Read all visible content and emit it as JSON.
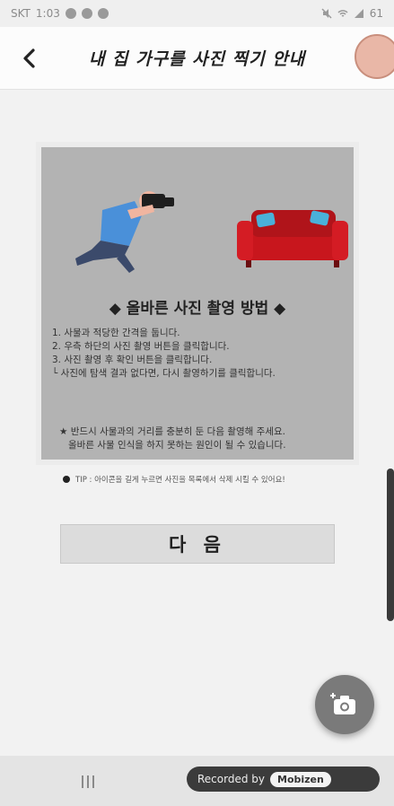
{
  "status_bar": {
    "carrier": "SKT",
    "time": "1:03",
    "battery": "61"
  },
  "header": {
    "title": "내 집 가구를 사진 찍기 안내"
  },
  "guide": {
    "heading": "◆ 올바른 사진 촬영 방법 ◆",
    "steps": [
      "1. 사물과 적당한 간격을 둡니다.",
      "2. 우측 하단의 사진 촬영 버튼을 클릭합니다.",
      "3. 사진 촬영 후 확인 버튼을 클릭합니다.",
      "└ 사진에 탐색 결과 없다면, 다시 촬영하기를 클릭합니다."
    ],
    "note": [
      "★ 반드시 사물과의 거리를 충분히 둔 다음 촬영해 주세요.",
      "올바른 사물 인식을 하지 못하는 원인이 될 수 있습니다."
    ]
  },
  "tip": "TIP : 아이콘을 길게 누르면 사진을 목록에서 삭제 시킬 수 있어요!",
  "next_button": "다 음",
  "recorder": {
    "label": "Recorded by",
    "brand": "Mobizen"
  },
  "colors": {
    "sofa": "#c8161d",
    "person_shirt": "#4a90d9",
    "person_pants": "#3b4a6b",
    "card_background": "#b3b3b3"
  },
  "icons": {
    "back": "back-arrow-icon",
    "fab": "camera-add-icon",
    "nav_recent": "recent-apps-icon"
  }
}
